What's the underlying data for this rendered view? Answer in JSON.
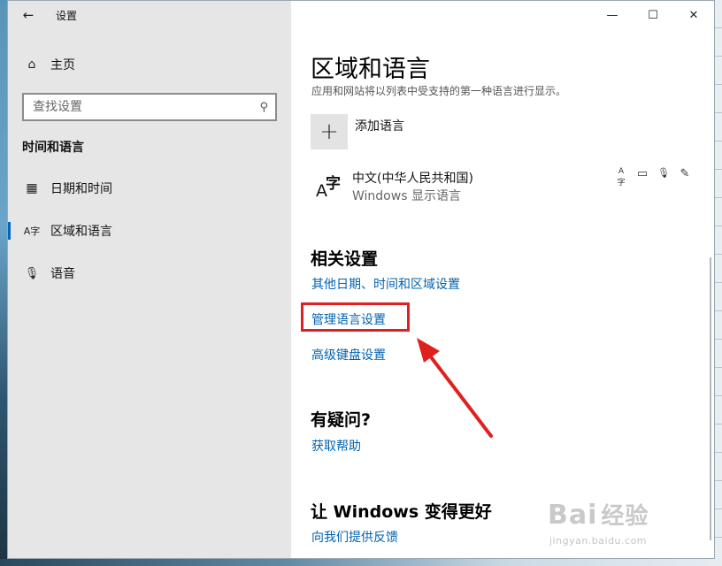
{
  "window": {
    "app_title": "设置",
    "controls": {
      "minimize": "—",
      "maximize": "☐",
      "close": "✕"
    }
  },
  "sidebar": {
    "back_icon": "←",
    "home": {
      "icon": "home-icon",
      "glyph": "⌂",
      "label": "主页"
    },
    "search": {
      "placeholder": "查找设置",
      "icon": "search-icon",
      "glyph": "⚲"
    },
    "section_title": "时间和语言",
    "items": [
      {
        "icon": "calendar-clock-icon",
        "glyph": "▦",
        "label": "日期和时间",
        "active": false
      },
      {
        "icon": "language-icon",
        "glyph": "A字",
        "label": "区域和语言",
        "active": true
      },
      {
        "icon": "microphone-icon",
        "glyph": "🎙",
        "label": "语音",
        "active": false
      }
    ]
  },
  "main": {
    "title": "区域和语言",
    "description": "应用和网站将以列表中受支持的第一种语言进行显示。",
    "add_language": {
      "glyph": "+",
      "label": "添加语言"
    },
    "language": {
      "glyph_a": "A",
      "glyph_zi": "字",
      "name": "中文(中华人民共和国)",
      "subtitle": "Windows 显示语言",
      "feature_icons": [
        "text-language-icon",
        "display-language-icon",
        "speech-icon",
        "handwriting-icon"
      ],
      "feature_glyphs": [
        "A字",
        "▭",
        "🎙",
        "✎"
      ]
    },
    "related": {
      "heading": "相关设置",
      "links": [
        "其他日期、时间和区域设置",
        "管理语言设置",
        "高级键盘设置"
      ]
    },
    "question": {
      "heading": "有疑问?",
      "link": "获取帮助"
    },
    "feedback": {
      "heading": "让 Windows 变得更好",
      "link": "向我们提供反馈"
    }
  },
  "annotation": {
    "highlight_color": "#e02020"
  },
  "watermark": {
    "brand": "Bai",
    "brand_cn": "经验",
    "url": "jingyan.baidu.com"
  }
}
